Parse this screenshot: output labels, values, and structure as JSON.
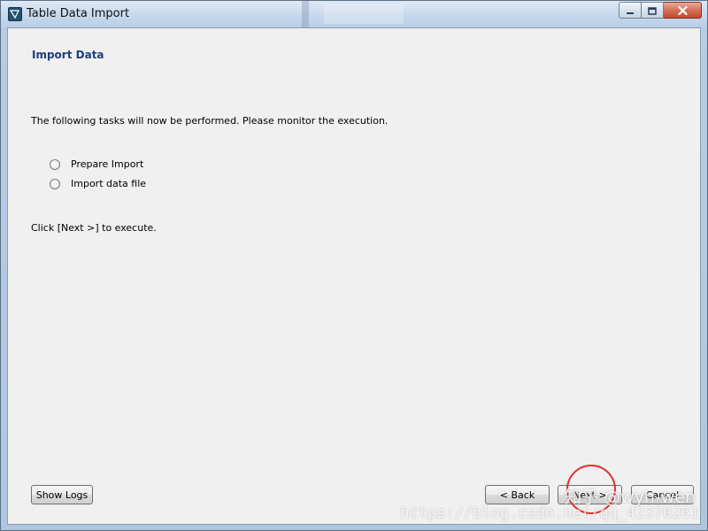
{
  "window": {
    "title": "Table Data Import",
    "caption": {
      "minimize_icon": "minimize-icon",
      "maximize_icon": "maximize-icon",
      "close_icon": "close-icon"
    }
  },
  "page": {
    "heading": "Import Data",
    "description": "The following tasks will now be performed. Please monitor the execution.",
    "tasks": [
      {
        "label": "Prepare Import",
        "state": "pending"
      },
      {
        "label": "Import data file",
        "state": "pending"
      }
    ],
    "hint": "Click [Next >] to execute."
  },
  "buttons": {
    "show_logs": "Show Logs",
    "back": "< Back",
    "next": "Next >",
    "cancel": "Cancel"
  },
  "overlay": {
    "watermark_site": "知乎 @wyh-wen",
    "watermark_url": "https://blog.csdn.net/qq_42370261"
  },
  "colors": {
    "heading": "#1e3f78",
    "annotation": "#e0312a"
  }
}
